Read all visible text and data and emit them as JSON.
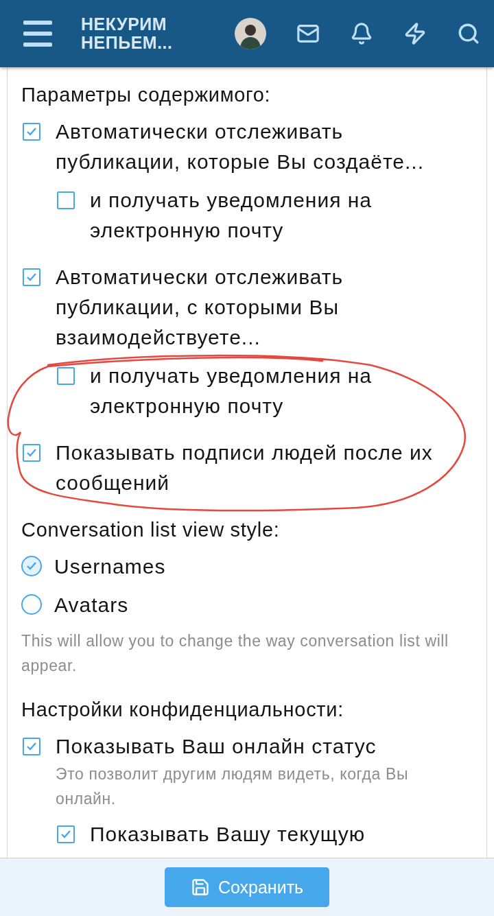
{
  "header": {
    "logo": "НЕКУРИМ НЕПЬЕМ..."
  },
  "sections": [
    {
      "title": "Параметры содержимого:",
      "items": [
        {
          "kind": "checkbox",
          "label": "Автоматически отслеживать публикации, которые Вы создаёте...",
          "checked": true,
          "children": [
            {
              "kind": "checkbox",
              "label": "и получать уведомления на электронную почту",
              "checked": false
            }
          ]
        },
        {
          "kind": "checkbox",
          "label": "Автоматически отслеживать публикации, с которыми Вы взаимодействуете...",
          "checked": true,
          "children": [
            {
              "kind": "checkbox",
              "label": "и получать уведомления на электронную почту",
              "checked": false
            }
          ]
        },
        {
          "kind": "checkbox",
          "label": "Показывать подписи людей после их сообщений",
          "checked": true
        }
      ]
    },
    {
      "title": "Conversation list view style:",
      "items": [
        {
          "kind": "radio",
          "label": "Usernames",
          "selected": true
        },
        {
          "kind": "radio",
          "label": "Avatars",
          "selected": false
        }
      ],
      "hint": "This will allow you to change the way conversation list will appear."
    },
    {
      "title": "Настройки конфиденциальности:",
      "items": [
        {
          "kind": "checkbox",
          "label": "Показывать Ваш онлайн статус",
          "checked": true,
          "hint": "Это позволит другим людям видеть, когда Вы онлайн.",
          "children": [
            {
              "kind": "checkbox",
              "label": "Показывать Вашу текущую",
              "checked": true
            }
          ]
        }
      ]
    }
  ],
  "footer": {
    "save_button": "Сохранить"
  }
}
